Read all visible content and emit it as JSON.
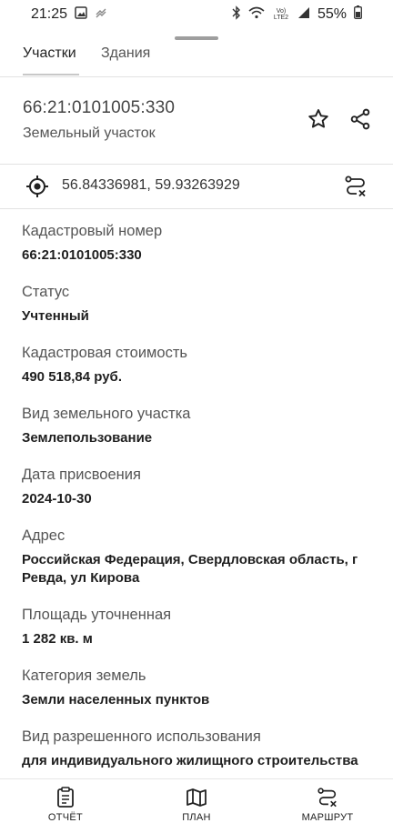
{
  "status_bar": {
    "time": "21:25",
    "network": "Vo) LTE2",
    "battery": "55%"
  },
  "tabs": [
    {
      "label": "Участки",
      "active": true
    },
    {
      "label": "Здания",
      "active": false
    }
  ],
  "header": {
    "cadastral_number": "66:21:0101005:330",
    "type": "Земельный участок",
    "icons": [
      "star-icon",
      "share-icon"
    ]
  },
  "location": {
    "coordinates": "56.84336981, 59.93263929",
    "icons": [
      "target-icon",
      "route-icon"
    ]
  },
  "fields": [
    {
      "label": "Кадастровый номер",
      "value": "66:21:0101005:330"
    },
    {
      "label": "Статус",
      "value": "Учтенный"
    },
    {
      "label": "Кадастровая стоимость",
      "value": "490 518,84 руб."
    },
    {
      "label": "Вид земельного участка",
      "value": "Землепользование"
    },
    {
      "label": "Дата присвоения",
      "value": "2024-10-30"
    },
    {
      "label": "Адрес",
      "value": "Российская Федерация, Свердловская область, г Ревда, ул Кирова"
    },
    {
      "label": "Площадь уточненная",
      "value": "1 282 кв. м"
    },
    {
      "label": "Категория земель",
      "value": "Земли населенных пунктов"
    },
    {
      "label": "Вид разрешенного использования",
      "value": "для индивидуального жилищного строительства"
    }
  ],
  "bottom_nav": [
    {
      "label": "ОТЧЁТ",
      "icon": "report-icon"
    },
    {
      "label": "ПЛАН",
      "icon": "map-icon"
    },
    {
      "label": "МАРШРУТ",
      "icon": "route-icon"
    }
  ],
  "colors": {
    "text_primary": "#1f1f1f",
    "text_secondary": "#555555",
    "divider": "#e2e2e2"
  }
}
